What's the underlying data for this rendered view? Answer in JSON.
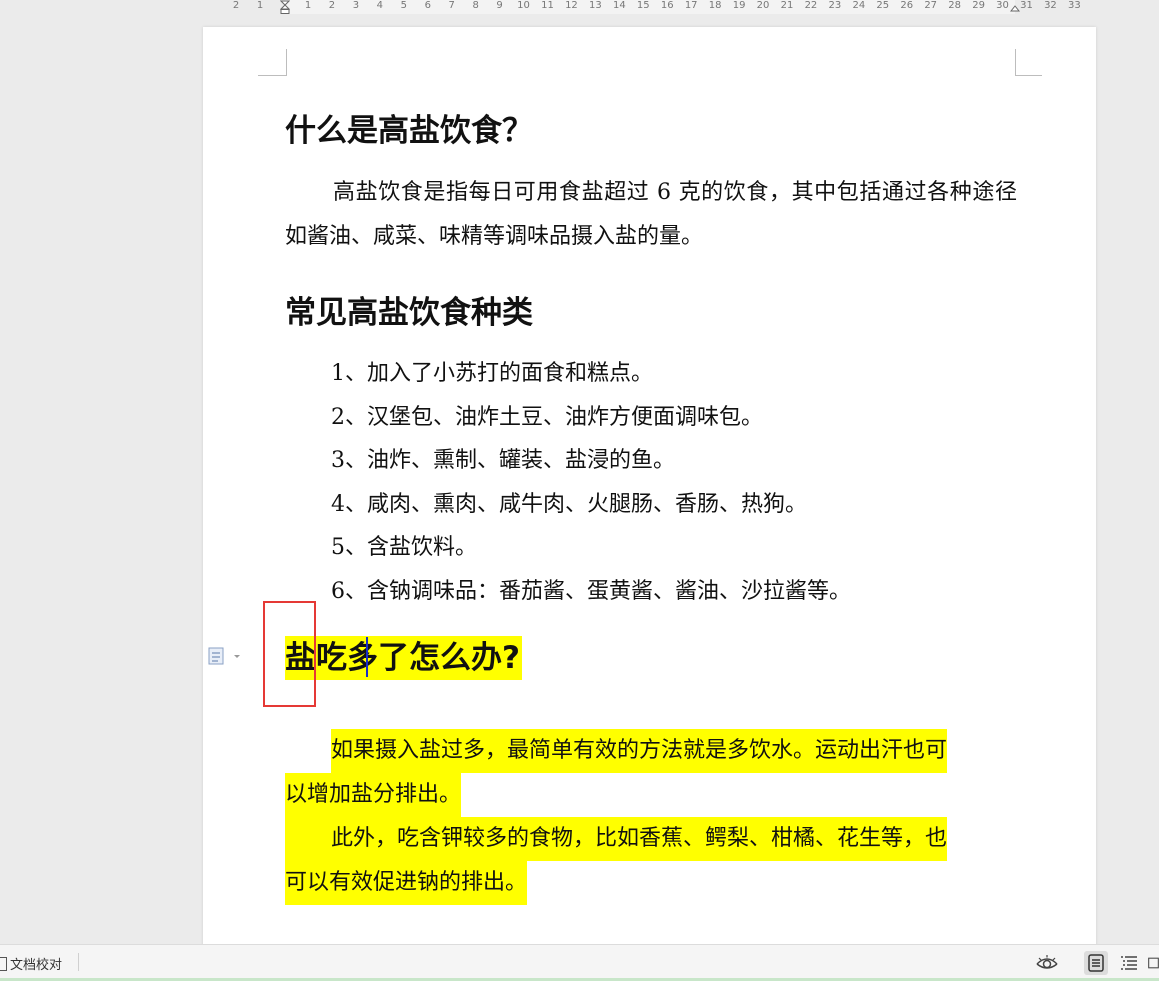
{
  "ruler": {
    "numbers": [
      "2",
      "1",
      "1",
      "2",
      "3",
      "4",
      "5",
      "6",
      "7",
      "8",
      "9",
      "10",
      "11",
      "12",
      "13",
      "14",
      "15",
      "16",
      "17",
      "18",
      "19",
      "20",
      "21",
      "22",
      "23",
      "24",
      "25",
      "26",
      "27",
      "28",
      "29",
      "30",
      "31",
      "32",
      "33"
    ]
  },
  "document": {
    "heading1": "什么是高盐饮食？",
    "paragraph1": "高盐饮食是指每日可用食盐超过 6 克的饮食，其中包括通过各种途径如酱油、咸菜、味精等调味品摄入盐的量。",
    "heading2": "常见高盐饮食种类",
    "list": [
      "1、加入了小苏打的面食和糕点。",
      "2、汉堡包、油炸土豆、油炸方便面调味包。",
      "3、油炸、熏制、罐装、盐浸的鱼。",
      "4、咸肉、熏肉、咸牛肉、火腿肠、香肠、热狗。",
      "5、含盐饮料。",
      "6、含钠调味品：番茄酱、蛋黄酱、酱油、沙拉酱等。"
    ],
    "heading3": "盐吃多了怎么办?",
    "para3_line1": "如果摄入盐过多，最简单有效的方法就是多饮水。运动出汗也可",
    "para3_line2": "以增加盐分排出。",
    "para4_line1": "此外，吃含钾较多的食物，比如香蕉、鳄梨、柑橘、花生等，也",
    "para4_line2": "可以有效促进钠的排出。",
    "highlight_color": "#ffff00"
  },
  "statusbar": {
    "proofread_label": "文档校对",
    "icons": [
      "eye-icon",
      "page-view-icon",
      "outline-view-icon",
      "web-view-icon"
    ]
  }
}
